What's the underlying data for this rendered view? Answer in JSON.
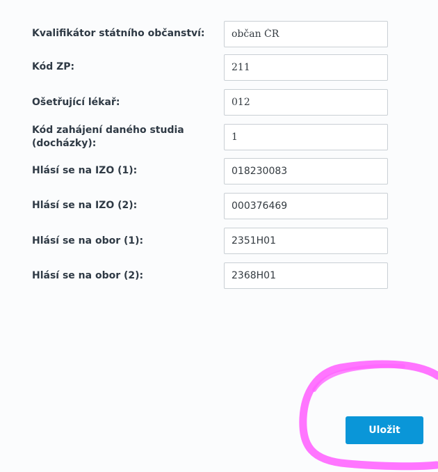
{
  "form": {
    "fields": [
      {
        "label": "Kvalifikátor státního občanství:",
        "value": "občan ČR"
      },
      {
        "label": "Kód ZP:",
        "value": "211"
      },
      {
        "label": "Ošetřující lékař:",
        "value": "012"
      },
      {
        "label": "Kód zahájení daného studia (docházky):",
        "value": "1"
      },
      {
        "label": "Hlásí se na IZO (1):",
        "value": "018230083"
      },
      {
        "label": "Hlásí se na IZO (2):",
        "value": "000376469"
      },
      {
        "label": "Hlásí se na obor (1):",
        "value": "2351H01"
      },
      {
        "label": "Hlásí se na obor (2):",
        "value": "2368H01"
      }
    ]
  },
  "actions": {
    "save_label": "Uložit"
  },
  "colors": {
    "primary": "#0a96d8",
    "annotation": "#ff66ff"
  }
}
